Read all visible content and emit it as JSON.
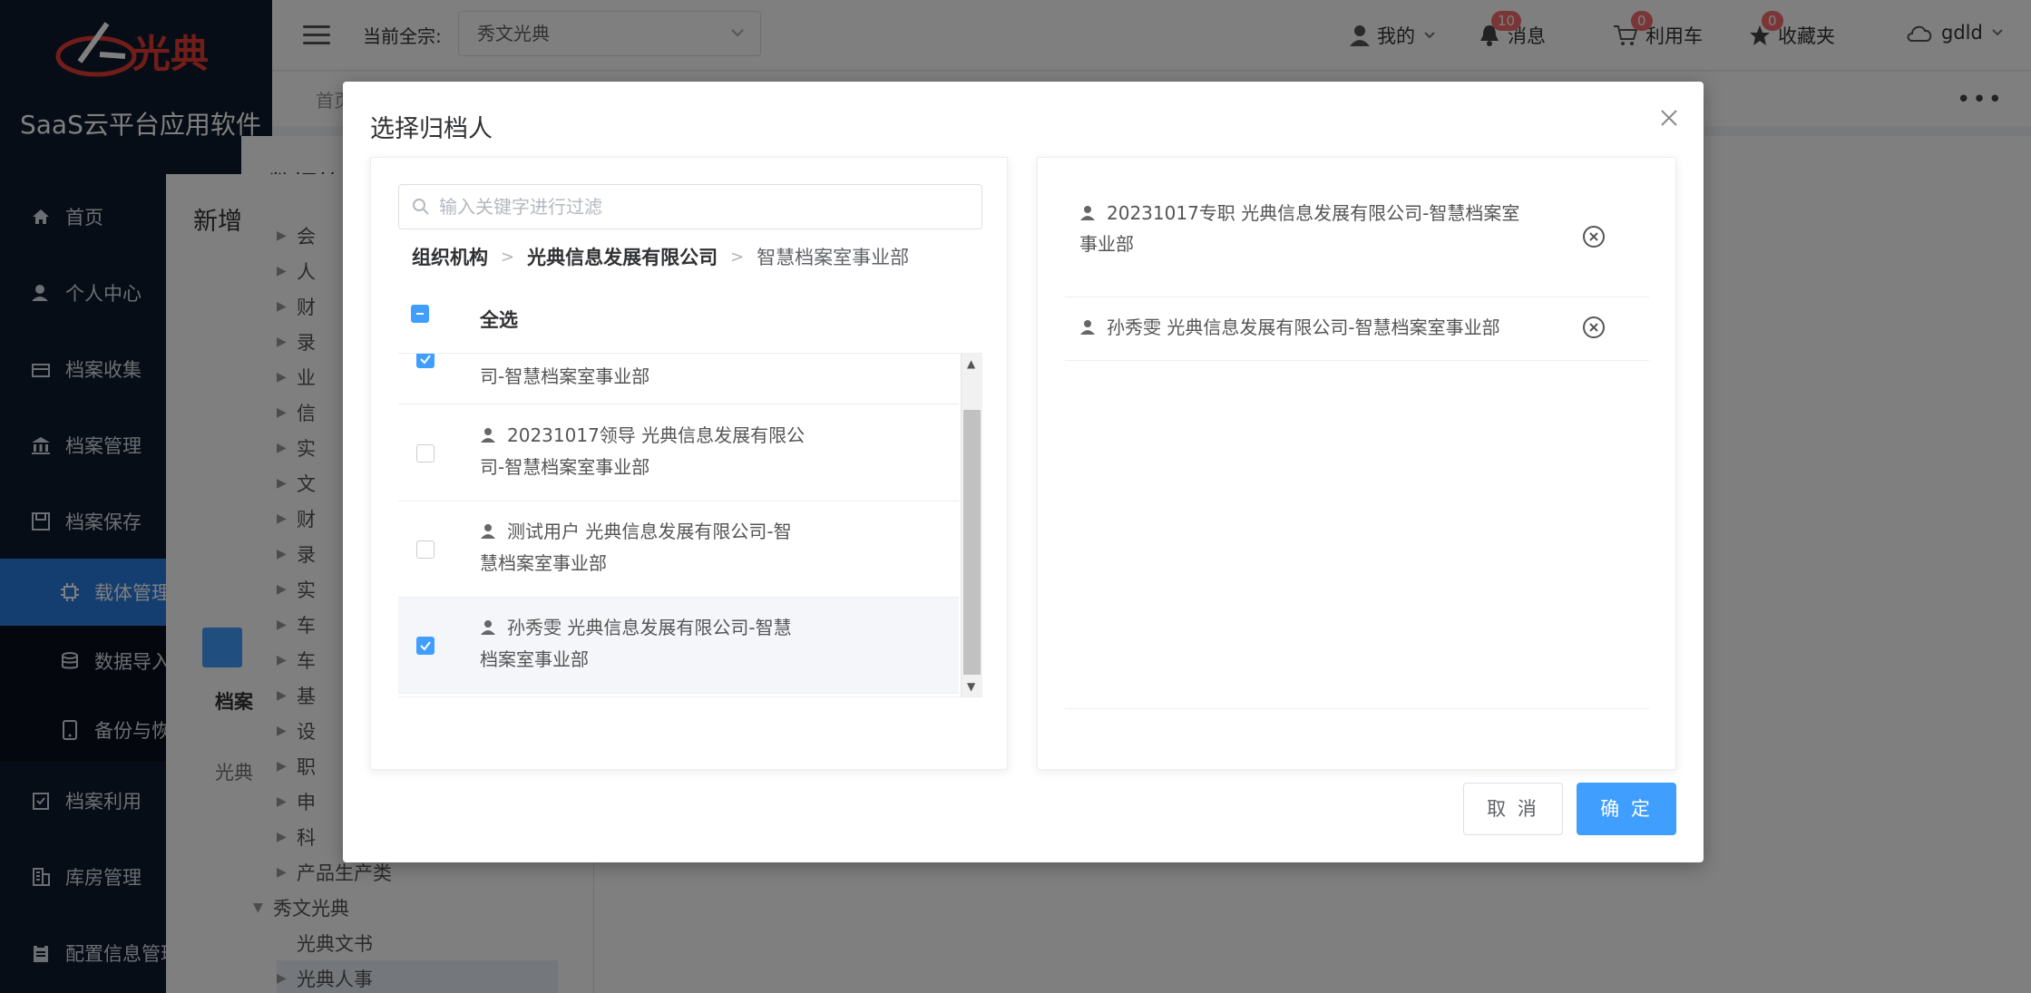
{
  "colors": {
    "primary": "#409eff",
    "sidebar": "#0f1a2c",
    "active_nav": "#2b7de0",
    "badge": "#f56c6c"
  },
  "sidebar": {
    "logo_text": "光典",
    "brand_title": "SaaS云平台应用软件",
    "items": [
      {
        "label": "首页",
        "icon": "home-icon"
      },
      {
        "label": "个人中心",
        "icon": "user-icon"
      },
      {
        "label": "档案收集",
        "icon": "inbox-icon"
      },
      {
        "label": "档案管理",
        "icon": "bank-icon"
      },
      {
        "label": "档案保存",
        "icon": "save-icon"
      },
      {
        "label": "载体管理",
        "icon": "chip-icon"
      },
      {
        "label": "数据导入",
        "icon": "database-icon"
      },
      {
        "label": "备份与恢复",
        "icon": "tablet-icon"
      },
      {
        "label": "档案利用",
        "icon": "check-list-icon"
      },
      {
        "label": "库房管理",
        "icon": "building-icon"
      },
      {
        "label": "配置信息管理",
        "icon": "clipboard-icon"
      }
    ]
  },
  "header": {
    "current_label": "当前全宗:",
    "current_value": "秀文光典",
    "my_label": "我的",
    "msg_label": "消息",
    "msg_count": "10",
    "cart_label": "利用车",
    "cart_count": "0",
    "fav_label": "收藏夹",
    "fav_count": "0",
    "user": "gdld"
  },
  "subbar": {
    "crumb": "首页"
  },
  "background": {
    "dialog1_title": "数据筛",
    "dialog2_title": "新增",
    "tree_items": [
      "会",
      "人",
      "财",
      "录",
      "业",
      "信",
      "实",
      "文",
      "财",
      "录",
      "实",
      "车",
      "车",
      "基",
      "设",
      "职",
      "申",
      "科",
      "产品生产类",
      "秀文光典",
      "光典文书",
      "光典人事"
    ],
    "left_button_icon": "edit-icon",
    "left_label": "档案",
    "left_value": "光典"
  },
  "modal": {
    "title": "选择归档人",
    "search_placeholder": "输入关键字进行过滤",
    "breadcrumb": [
      "组织机构",
      "光典信息发展有限公司",
      "智慧档案室事业部"
    ],
    "select_all_label": "全选",
    "list_items": [
      {
        "line1": "",
        "line2": "司-智慧档案室事业部",
        "checked": true,
        "has_icon": false
      },
      {
        "line1": "20231017领导   光典信息发展有限公",
        "line2": "司-智慧档案室事业部",
        "checked": false,
        "has_icon": true
      },
      {
        "line1": "测试用户   光典信息发展有限公司-智",
        "line2": "慧档案室事业部",
        "checked": false,
        "has_icon": true
      },
      {
        "line1": "孙秀雯   光典信息发展有限公司-智慧",
        "line2": "档案室事业部",
        "checked": true,
        "has_icon": true
      }
    ],
    "selected": [
      {
        "line1": "20231017专职   光典信息发展有限公司-智慧档案室",
        "line2": "事业部"
      },
      {
        "line1": "孙秀雯   光典信息发展有限公司-智慧档案室事业部",
        "line2": ""
      }
    ],
    "cancel_label": "取 消",
    "ok_label": "确 定"
  }
}
